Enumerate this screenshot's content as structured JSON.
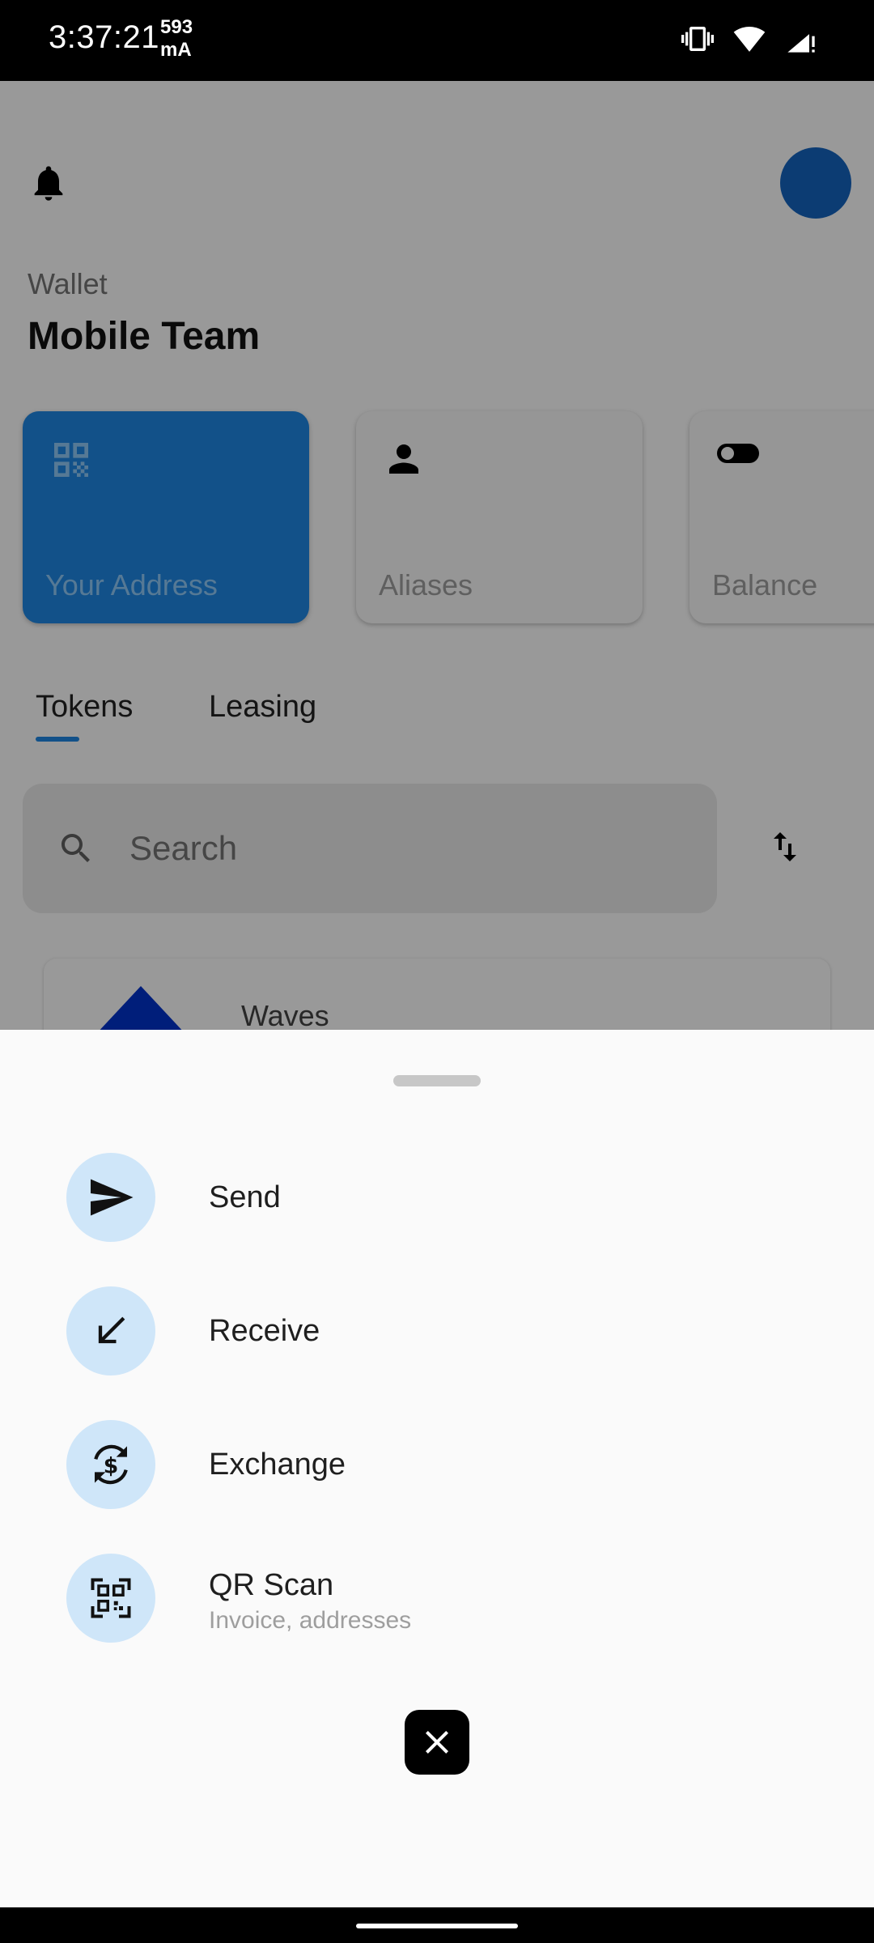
{
  "status_bar": {
    "time": "3:37:21",
    "current_value": "593",
    "current_unit": "mA",
    "icons": [
      "vibrate-icon",
      "wifi-icon",
      "signal-icon"
    ]
  },
  "header": {
    "notification_icon": "bell-icon",
    "avatar_color": "#1565c0"
  },
  "wallet": {
    "label": "Wallet",
    "name": "Mobile Team"
  },
  "cards": [
    {
      "label": "Your Address",
      "icon": "qr-code-icon",
      "color": "#1e88e5"
    },
    {
      "label": "Aliases",
      "icon": "person-icon"
    },
    {
      "label": "Balance",
      "icon": "toggle-icon"
    }
  ],
  "tabs": [
    {
      "label": "Tokens",
      "active": true
    },
    {
      "label": "Leasing",
      "active": false
    }
  ],
  "search": {
    "placeholder": "Search"
  },
  "tokens": [
    {
      "name": "Waves"
    }
  ],
  "sheet": {
    "actions": [
      {
        "label": "Send",
        "icon": "send-icon"
      },
      {
        "label": "Receive",
        "icon": "receive-arrow-icon"
      },
      {
        "label": "Exchange",
        "icon": "exchange-icon"
      },
      {
        "label": "QR Scan",
        "subtitle": "Invoice, addresses",
        "icon": "qr-scan-icon"
      }
    ],
    "close_icon": "close-icon"
  },
  "colors": {
    "accent": "#1e88e5",
    "action_circle": "#cfe6f9",
    "sheet_background": "#fafafa"
  }
}
